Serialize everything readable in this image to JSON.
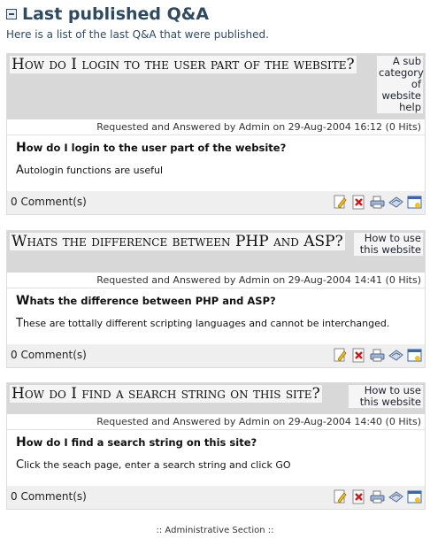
{
  "page": {
    "title": "Last published Q&A",
    "subtitle": "Here is a list of the last Q&A that were published."
  },
  "items": [
    {
      "title": "How do I login to the user part of the website?",
      "category": "A sub category of website help",
      "meta": "Requested and Answered by Admin on 29-Aug-2004 16:12 (0 Hits)",
      "question_first": "H",
      "question_rest": "ow do I login to the user part of the website?",
      "answer_first": "A",
      "answer_rest": "utologin functions are useful",
      "comments": "0 Comment(s)"
    },
    {
      "title": "Whats the difference between PHP and ASP?",
      "category": "How to use this website",
      "meta": "Requested and Answered by Admin on 29-Aug-2004 14:41 (0 Hits)",
      "question_first": "W",
      "question_rest": "hats the difference between PHP and ASP?",
      "answer_first": "T",
      "answer_rest": "hese are tottally different scripting languages and cannot be interchanged.",
      "comments": "0 Comment(s)"
    },
    {
      "title": "How do I find a search string on this site?",
      "category": "How to use this website",
      "meta": "Requested and Answered by Admin on 29-Aug-2004 14:40 (0 Hits)",
      "question_first": "H",
      "question_rest": "ow do I find a search string on this site?",
      "answer_first": "C",
      "answer_rest": "lick the seach page, enter a search string and click GO",
      "comments": "0 Comment(s)"
    }
  ],
  "icons": [
    "edit-icon",
    "delete-icon",
    "print-icon",
    "send-icon",
    "window-icon"
  ],
  "footer": ":: Administrative Section ::"
}
